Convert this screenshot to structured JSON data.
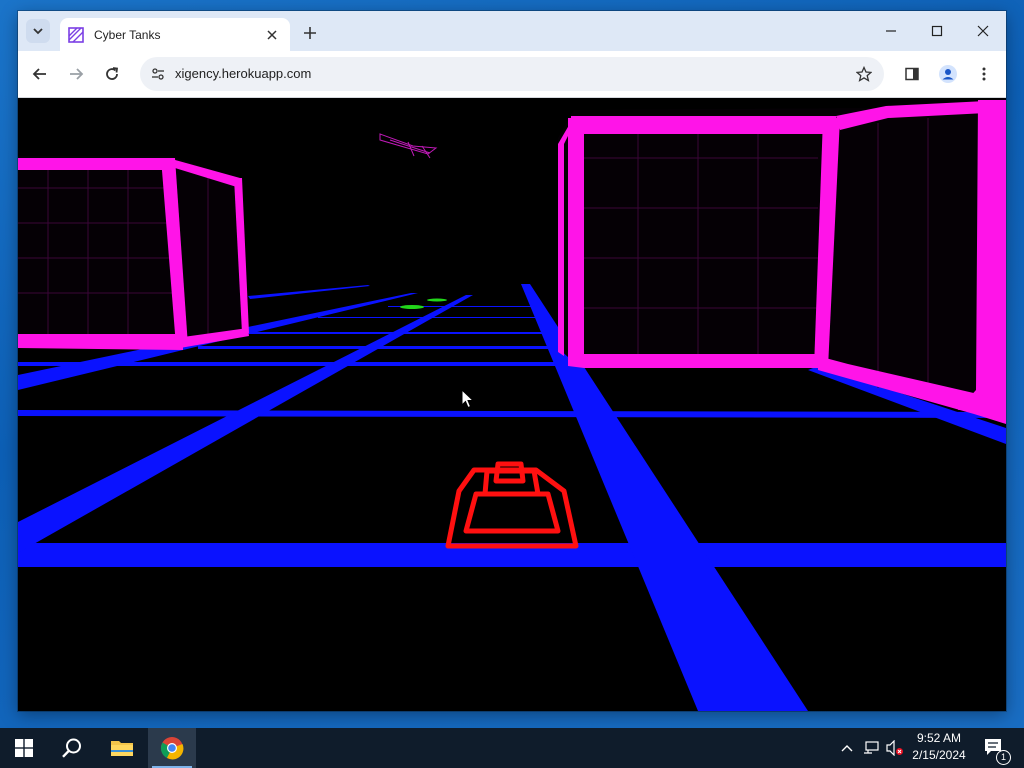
{
  "browser": {
    "tab_title": "Cyber Tanks",
    "url": "xigency.herokuapp.com"
  },
  "game": {
    "title": "Cyber Tanks",
    "colors": {
      "grid": "#0a12ff",
      "cubes": "#ff14e8",
      "player_tank": "#ff1010",
      "enemy_markers": "#22d61a",
      "background": "#000000"
    }
  },
  "taskbar": {
    "time": "9:52 AM",
    "date": "2/15/2024",
    "notification_count": "1",
    "icons": [
      "windows-start-icon",
      "search-icon",
      "file-explorer-icon",
      "chrome-icon"
    ]
  }
}
